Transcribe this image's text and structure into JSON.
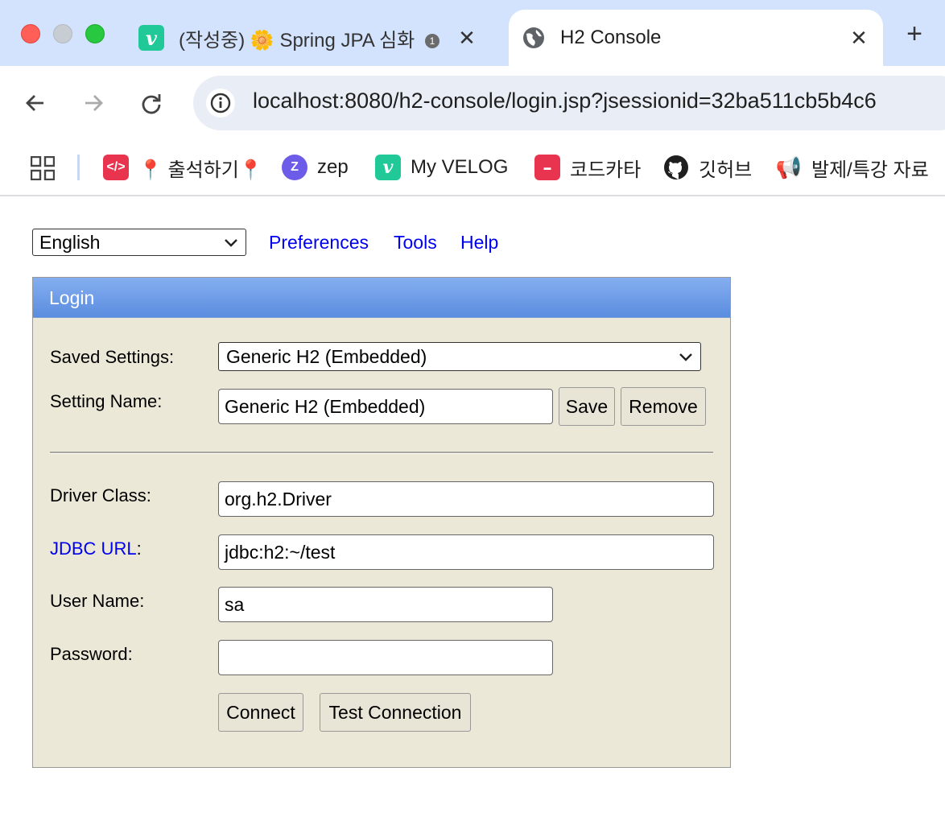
{
  "browser": {
    "tabs": [
      {
        "title": "(작성중) 🌼 Spring JPA 심화",
        "badge": "1",
        "trail": "-",
        "favicon": "v",
        "favicon_color": "#20c997"
      },
      {
        "title": "H2 Console",
        "favicon": "globe-icon"
      }
    ],
    "url": "localhost:8080/h2-console/login.jsp?jsessionid=32ba511cb5b4c6",
    "bookmarks": [
      {
        "label": "📍 출석하기📍",
        "icon": "code-heart-icon",
        "color": "#e8344e"
      },
      {
        "label": "zep",
        "icon": "zep-icon",
        "color": "#6c5ce7"
      },
      {
        "label": "My VELOG",
        "icon": "v",
        "color": "#20c997"
      },
      {
        "label": "코드카타",
        "icon": "sparta-icon",
        "color": "#e8344e"
      },
      {
        "label": "깃허브",
        "icon": "github-icon",
        "color": "#1f1f1f"
      },
      {
        "label": "발제/특강 자료",
        "icon": "megaphone-icon",
        "color": "#888888"
      }
    ]
  },
  "top_nav": {
    "language": "English",
    "links": [
      "Preferences",
      "Tools",
      "Help"
    ]
  },
  "login": {
    "title": "Login",
    "saved_settings_label": "Saved Settings:",
    "saved_settings_value": "Generic H2 (Embedded)",
    "setting_name_label": "Setting Name:",
    "setting_name_value": "Generic H2 (Embedded)",
    "save_button": "Save",
    "remove_button": "Remove",
    "driver_class_label": "Driver Class:",
    "driver_class_value": "org.h2.Driver",
    "jdbc_url_link": "JDBC URL",
    "jdbc_url_colon": ":",
    "jdbc_url_value": "jdbc:h2:~/test",
    "user_name_label": "User Name:",
    "user_name_value": "sa",
    "password_label": "Password:",
    "password_value": "",
    "connect_button": "Connect",
    "test_connection_button": "Test Connection"
  },
  "colors": {
    "header_gradient_top": "#85aef0",
    "header_gradient_bottom": "#5a8ddf",
    "panel_bg": "#ece8d8",
    "link": "#0000ee"
  }
}
